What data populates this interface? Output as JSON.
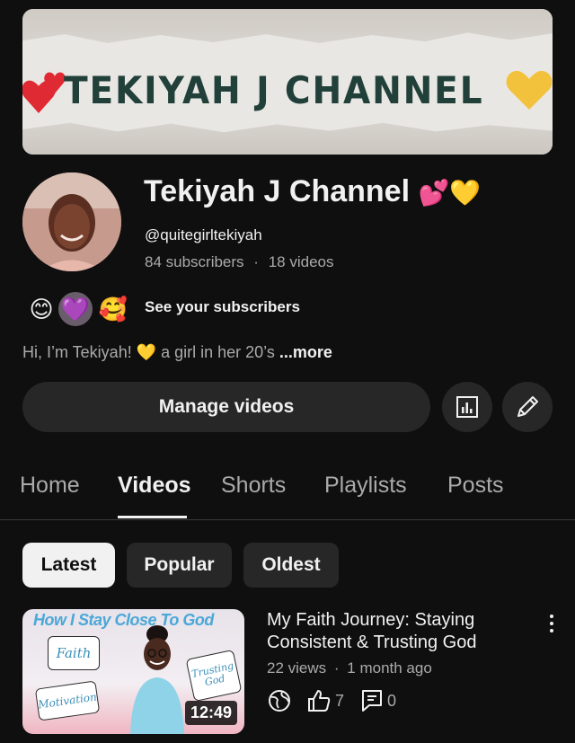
{
  "banner": {
    "text": "TEKIYAH J CHANNEL"
  },
  "channel": {
    "name": "Tekiyah J Channel",
    "name_emoji": "💕💛",
    "handle": "@quitegirltekiyah",
    "subscribers": "84 subscribers",
    "videos": "18 videos",
    "separator": "·"
  },
  "subscribers_row": {
    "avatars": [
      "😊",
      "💜",
      "🥰"
    ],
    "label": "See your subscribers"
  },
  "bio": {
    "text": "Hi, I’m Tekiyah! 💛 a girl in her 20’s",
    "more": "...more"
  },
  "actions": {
    "manage_videos": "Manage videos"
  },
  "tabs": [
    {
      "label": "Home"
    },
    {
      "label": "Videos"
    },
    {
      "label": "Shorts"
    },
    {
      "label": "Playlists"
    },
    {
      "label": "Posts"
    }
  ],
  "active_tab": "Videos",
  "chips": [
    {
      "label": "Latest"
    },
    {
      "label": "Popular"
    },
    {
      "label": "Oldest"
    }
  ],
  "active_chip": "Latest",
  "video": {
    "thumb_title": "How I Stay Close To God",
    "thumb_bubbles": [
      "Faith",
      "Trusting God",
      "Motivation"
    ],
    "duration": "12:49",
    "title": "My Faith Journey: Staying Consistent & Trusting God",
    "views": "22 views",
    "age": "1 month ago",
    "meta_separator": "·",
    "likes": "7",
    "comments": "0"
  },
  "colors": {
    "background": "#0f0f0f",
    "surface": "#272727",
    "text": "#f1f1f1",
    "muted": "#aaaaaa"
  }
}
